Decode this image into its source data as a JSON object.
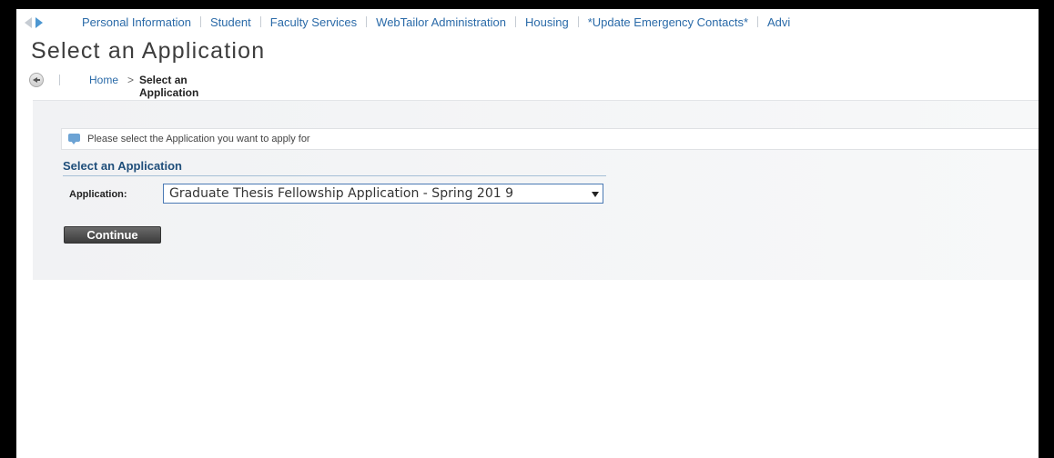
{
  "nav": {
    "items": [
      "Personal Information",
      "Student",
      "Faculty Services",
      "WebTailor Administration",
      "Housing",
      "*Update Emergency Contacts*",
      "Advi"
    ]
  },
  "page": {
    "title": "Select an Application"
  },
  "breadcrumb": {
    "home": "Home",
    "separator": ">",
    "current": "Select an Application"
  },
  "info": {
    "message": "Please select the Application you want to apply for"
  },
  "form": {
    "section_title": "Select an Application",
    "application_label": "Application:",
    "application_selected": "Graduate Thesis Fellowship Application - Spring 201 9",
    "continue_label": "Continue"
  },
  "colors": {
    "link": "#2a6aa8",
    "panel": "#f1f2f4",
    "button": "#4a4a4a",
    "select_border": "#4a79b4"
  }
}
